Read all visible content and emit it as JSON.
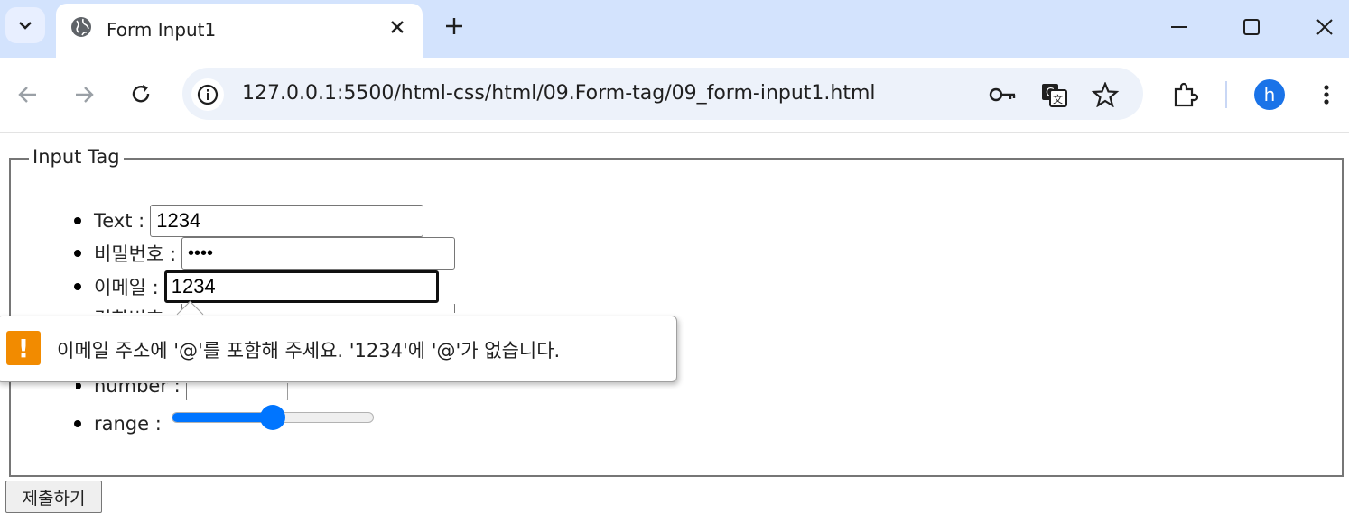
{
  "browser": {
    "tab_title": "Form Input1",
    "url": "127.0.0.1:5500/html-css/html/09.Form-tag/09_form-input1.html",
    "avatar_letter": "h",
    "icons": [
      "tab-search-icon",
      "globe-icon",
      "close-icon",
      "plus-icon",
      "minimize-icon",
      "maximize-icon",
      "window-close-icon",
      "back-arrow-icon",
      "forward-arrow-icon",
      "reload-icon",
      "site-info-icon",
      "key-icon",
      "translate-icon",
      "star-icon",
      "extensions-icon",
      "kebab-menu-icon"
    ],
    "accent_color": "#1a73e8",
    "tabbar_color": "#d3e3fd"
  },
  "form": {
    "legend": "Input Tag",
    "fields": [
      {
        "label": "Text :",
        "value": "1234"
      },
      {
        "label": "비밀번호 :",
        "value": "••••"
      },
      {
        "label": "이메일 :",
        "value": "1234"
      },
      {
        "label": "검화번호 :",
        "value": ""
      },
      {
        "label": "",
        "value": ""
      },
      {
        "label": "number :",
        "value": ""
      },
      {
        "label": "range :",
        "value": 50
      }
    ],
    "range_fraction": 0.5,
    "range_color": "#0075ff",
    "submit_label": "제출하기"
  },
  "validation": {
    "message": "이메일 주소에 '@'를 포함해 주세요. '1234'에 '@'가 없습니다.",
    "icon_color": "#f28b00"
  }
}
